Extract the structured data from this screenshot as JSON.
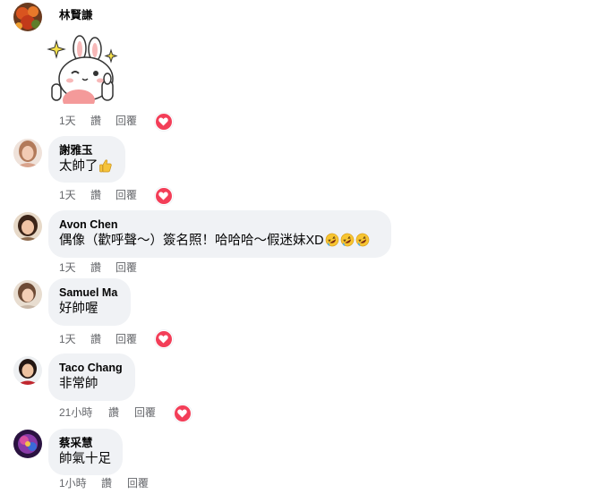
{
  "comments": [
    {
      "author": "林賢謙",
      "text": "",
      "time": "1天",
      "like": "讚",
      "reply": "回覆",
      "reaction": "heart",
      "avatar_color": "#b8461e"
    },
    {
      "author": "謝雅玉",
      "text": "太帥了",
      "time": "1天",
      "like": "讚",
      "reply": "回覆",
      "reaction": "heart",
      "avatar_color": "#c79a85"
    },
    {
      "author": "Avon Chen",
      "text": "偶像（歡呼聲～）簽名照！哈哈哈～假迷妹XD",
      "time": "1天",
      "like": "讚",
      "reply": "回覆",
      "reaction": "",
      "avatar_color": "#5b3a2a"
    },
    {
      "author": "Samuel Ma",
      "text": "好帥喔",
      "time": "1天",
      "like": "讚",
      "reply": "回覆",
      "reaction": "heart",
      "avatar_color": "#7a5a48"
    },
    {
      "author": "Taco Chang",
      "text": "非常帥",
      "time": "21小時",
      "like": "讚",
      "reply": "回覆",
      "reaction": "heart",
      "avatar_color": "#3a2a22"
    },
    {
      "author": "蔡采慧",
      "text": "帥氣十足",
      "time": "1小時",
      "like": "讚",
      "reply": "回覆",
      "reaction": "",
      "avatar_color": "#6a2a8a"
    }
  ],
  "icons": {
    "heart": "heart-icon",
    "thumbs_up": "thumbs-up-emoji",
    "laughing": "rolling-laughing-emoji",
    "sticker": "bunny-sticker"
  },
  "colors": {
    "bubble": "#f0f2f5",
    "meta": "#65676b",
    "heart": "#f33e58"
  }
}
